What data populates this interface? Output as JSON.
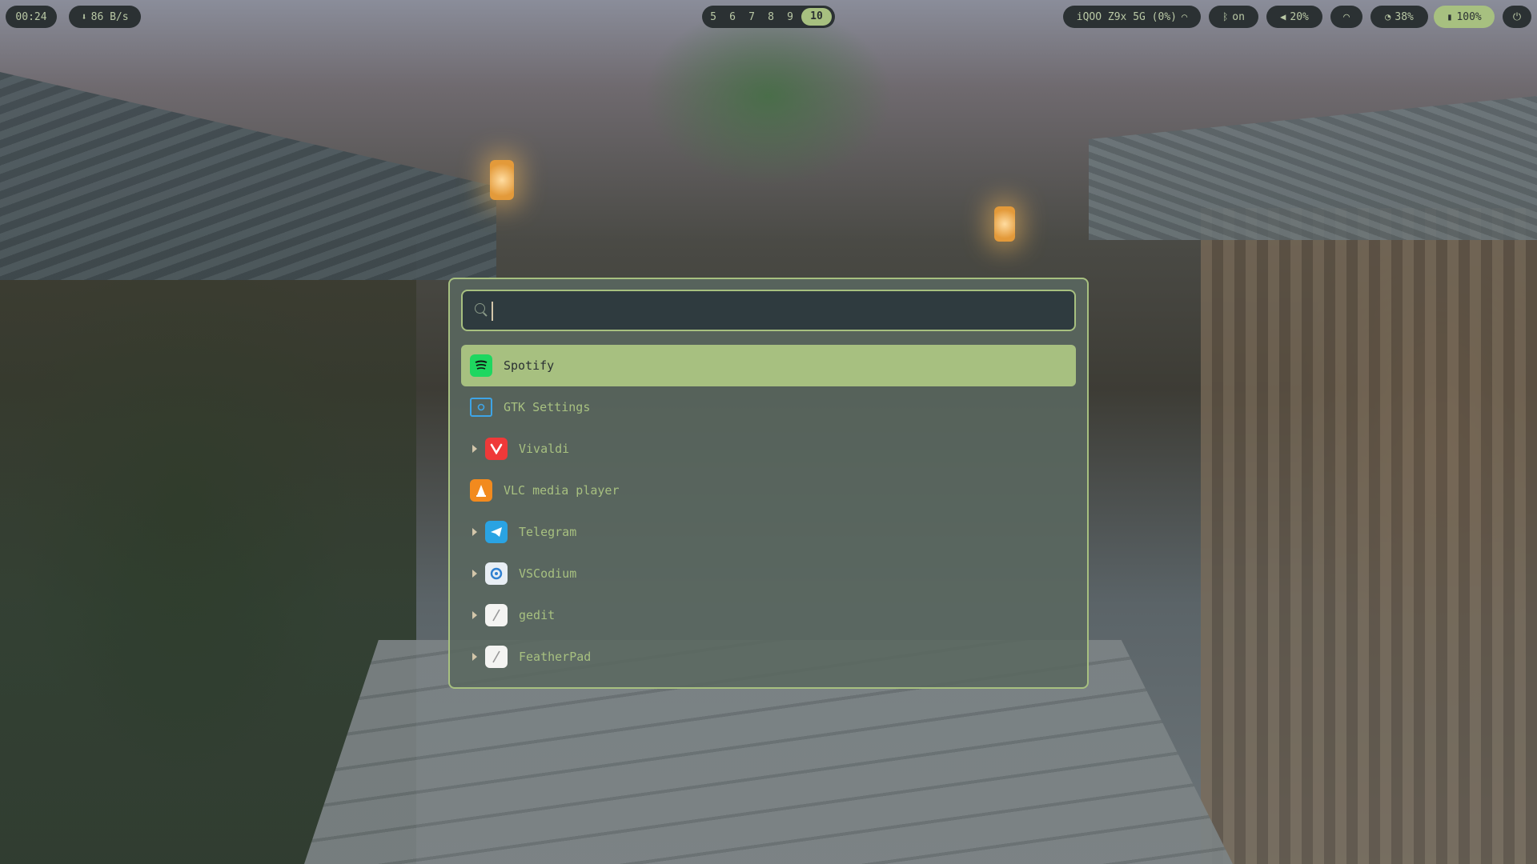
{
  "topbar": {
    "clock": "00:24",
    "network_speed": "86 B/s",
    "workspaces": [
      "5",
      "6",
      "7",
      "8",
      "9",
      "10"
    ],
    "active_workspace": "10",
    "wifi_network": "iQOO Z9x 5G (0%)",
    "bluetooth": "on",
    "volume": "20%",
    "cpu": "38%",
    "battery": "100%"
  },
  "launcher": {
    "search": {
      "value": "",
      "placeholder": ""
    },
    "items": [
      {
        "label": "Spotify",
        "icon": "spotify-icon",
        "selected": true,
        "expandable": false
      },
      {
        "label": "GTK Settings",
        "icon": "gtk-settings-icon",
        "selected": false,
        "expandable": false
      },
      {
        "label": "Vivaldi",
        "icon": "vivaldi-icon",
        "selected": false,
        "expandable": true
      },
      {
        "label": "VLC media player",
        "icon": "vlc-icon",
        "selected": false,
        "expandable": false
      },
      {
        "label": "Telegram",
        "icon": "telegram-icon",
        "selected": false,
        "expandable": true
      },
      {
        "label": "VSCodium",
        "icon": "vscodium-icon",
        "selected": false,
        "expandable": true
      },
      {
        "label": "gedit",
        "icon": "gedit-icon",
        "selected": false,
        "expandable": true
      },
      {
        "label": "FeatherPad",
        "icon": "featherpad-icon",
        "selected": false,
        "expandable": true
      }
    ]
  },
  "colors": {
    "accent": "#a7c080",
    "bar_bg": "#2b3133",
    "text": "#d3c6aa"
  }
}
